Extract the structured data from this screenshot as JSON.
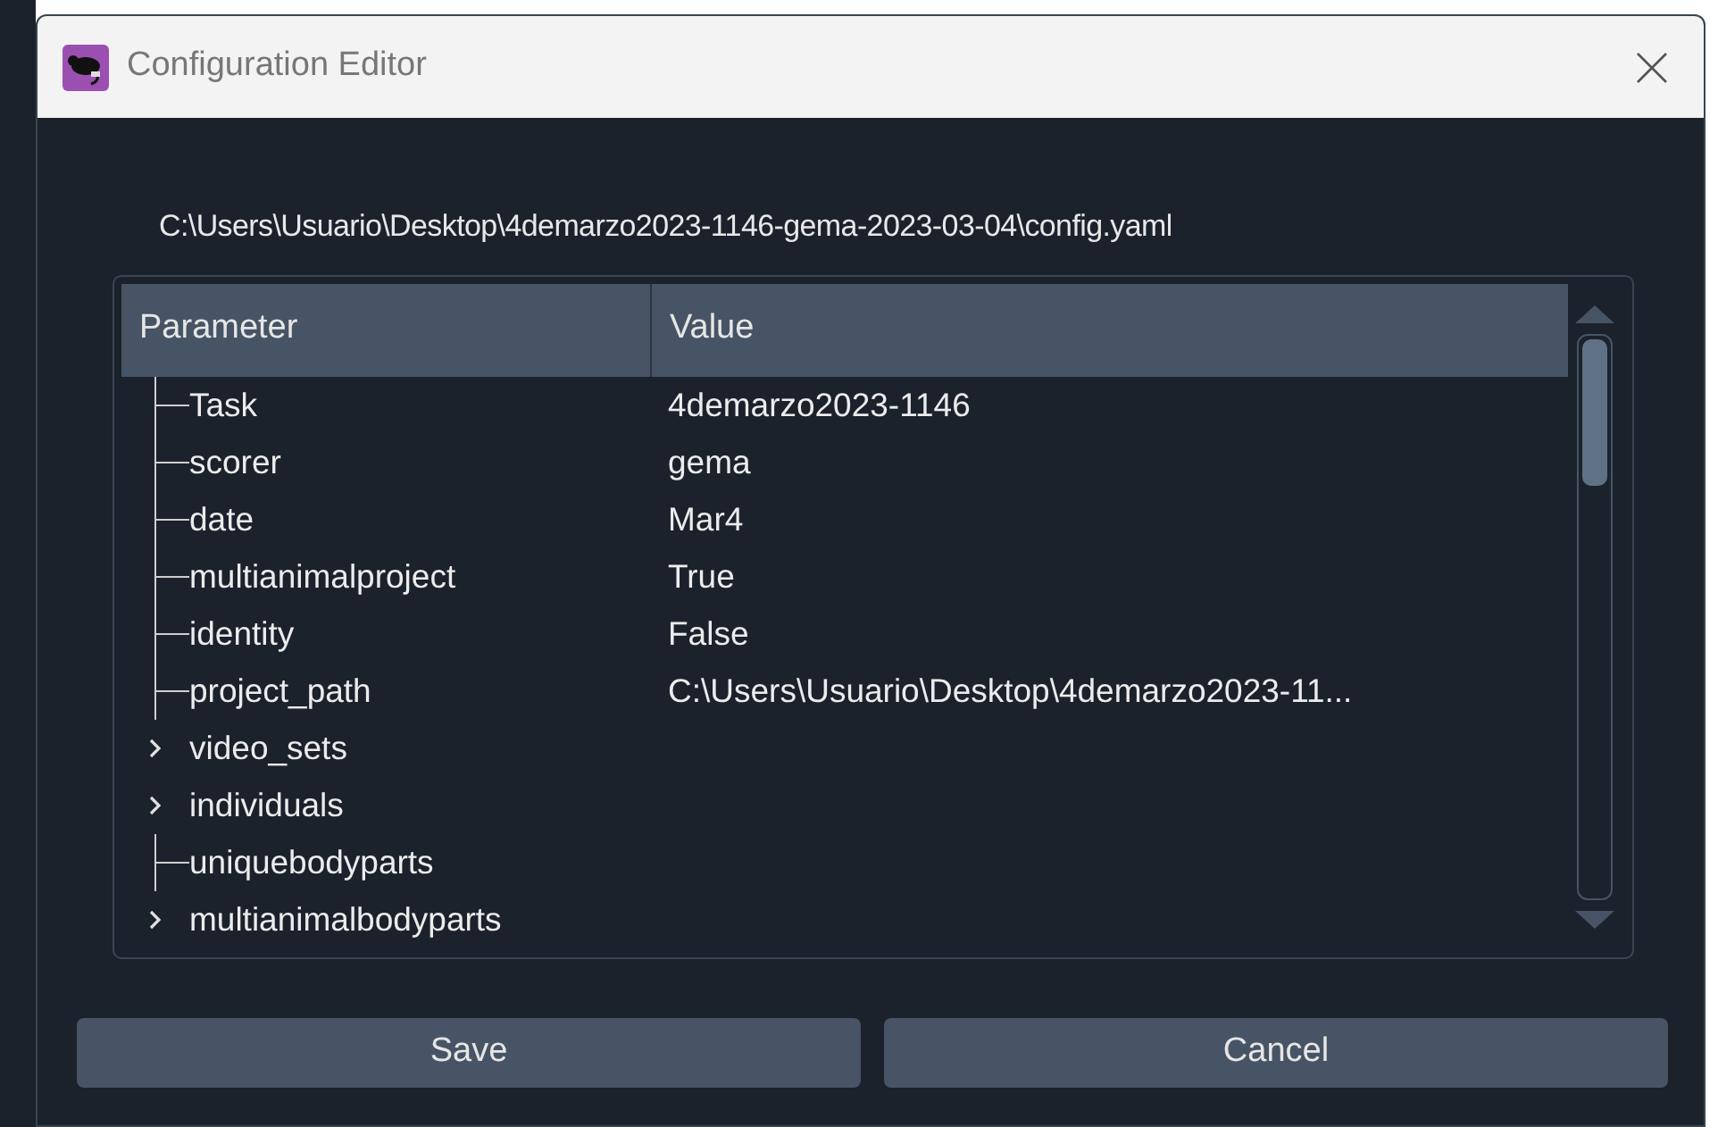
{
  "window": {
    "title": "Configuration Editor"
  },
  "file_path": "C:\\Users\\Usuario\\Desktop\\4demarzo2023-1146-gema-2023-03-04\\config.yaml",
  "tree": {
    "columns": [
      "Parameter",
      "Value"
    ],
    "rows": [
      {
        "kind": "leaf",
        "parameter": "Task",
        "value": "4demarzo2023-1146"
      },
      {
        "kind": "leaf",
        "parameter": "scorer",
        "value": "gema"
      },
      {
        "kind": "leaf",
        "parameter": "date",
        "value": "Mar4"
      },
      {
        "kind": "leaf",
        "parameter": "multianimalproject",
        "value": "True"
      },
      {
        "kind": "leaf",
        "parameter": "identity",
        "value": "False"
      },
      {
        "kind": "leaf",
        "parameter": "project_path",
        "value": "C:\\Users\\Usuario\\Desktop\\4demarzo2023-11..."
      },
      {
        "kind": "group",
        "parameter": "video_sets",
        "expanded": false
      },
      {
        "kind": "group",
        "parameter": "individuals",
        "expanded": false
      },
      {
        "kind": "leaf",
        "parameter": "uniquebodyparts"
      },
      {
        "kind": "group",
        "parameter": "multianimalbodyparts",
        "expanded": false
      }
    ]
  },
  "buttons": [
    "Save",
    "Cancel"
  ]
}
